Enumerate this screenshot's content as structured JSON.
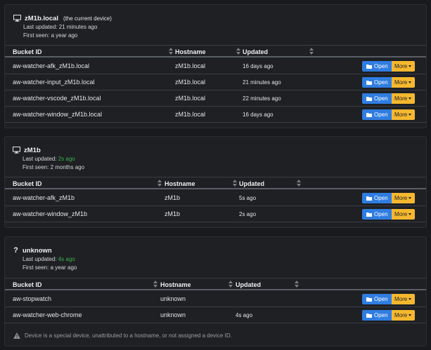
{
  "sections": [
    {
      "name": "zM1b.local",
      "note": "(the current device)",
      "last_updated_label": "Last updated:",
      "last_updated": "21 minutes ago",
      "first_seen_label": "First seen:",
      "first_seen": "a year ago",
      "rows": [
        {
          "bucket": "aw-watcher-afk_zM1b.local",
          "host": "zM1b.local",
          "updated": "16 days ago"
        },
        {
          "bucket": "aw-watcher-input_zM1b.local",
          "host": "zM1b.local",
          "updated": "21 minutes ago"
        },
        {
          "bucket": "aw-watcher-vscode_zM1b.local",
          "host": "zM1b.local",
          "updated": "22 minutes ago"
        },
        {
          "bucket": "aw-watcher-window_zM1b.local",
          "host": "zM1b.local",
          "updated": "16 days ago"
        }
      ]
    },
    {
      "name": "zM1b",
      "last_updated_label": "Last updated:",
      "last_updated": "2s ago",
      "first_seen_label": "First seen:",
      "first_seen": "2 months ago",
      "rows": [
        {
          "bucket": "aw-watcher-afk_zM1b",
          "host": "zM1b",
          "updated": "5s ago"
        },
        {
          "bucket": "aw-watcher-window_zM1b",
          "host": "zM1b",
          "updated": "2s ago"
        }
      ]
    },
    {
      "name": "unknown",
      "last_updated_label": "Last updated:",
      "last_updated": "4s ago",
      "first_seen_label": "First seen:",
      "first_seen": "a year ago",
      "rows": [
        {
          "bucket": "aw-stopwatch",
          "host": "unknown",
          "updated": ""
        },
        {
          "bucket": "aw-watcher-web-chrome",
          "host": "unknown",
          "updated": "4s ago"
        }
      ],
      "footnote": "Device is a special device, unattributed to a hostname, or not assigned a device ID."
    }
  ],
  "columns": {
    "bucket": "Bucket ID",
    "host": "Hostname",
    "updated": "Updated"
  },
  "buttons": {
    "open": "Open",
    "more": "More"
  },
  "colors": {
    "background": "#181a1d",
    "card": "#1e2024",
    "open_button": "#2f7de1",
    "more_button": "#f5b82e",
    "recent_green": "#3eb14f"
  },
  "icons": {
    "device": "monitor-icon",
    "unknown_device": "question-icon",
    "open": "folder-open-icon",
    "more": "caret-down-icon",
    "warning": "warning-icon"
  }
}
